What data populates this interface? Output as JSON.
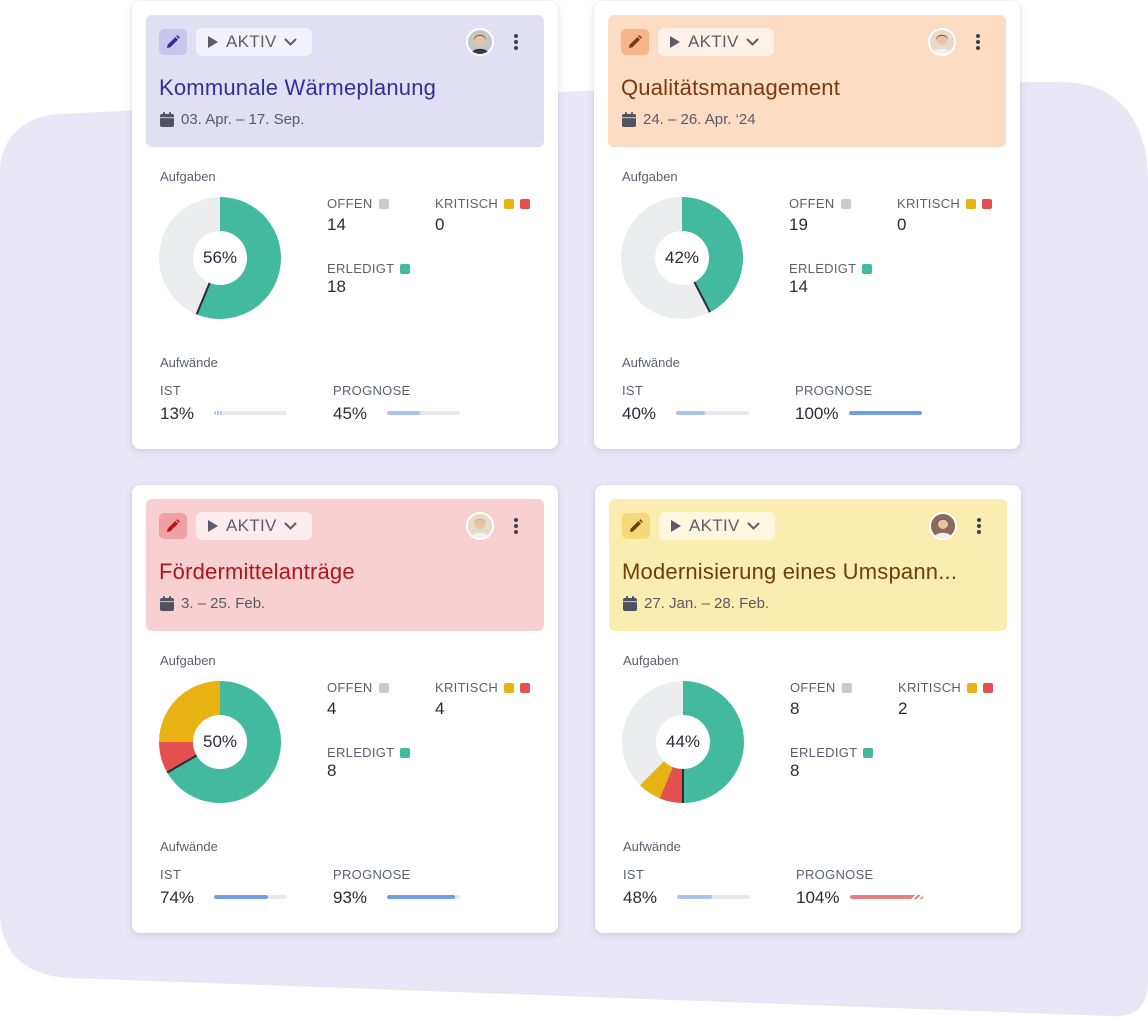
{
  "colors": {
    "done": "#43b99e",
    "open": "#ecedef",
    "critical_yellow": "#e8b213",
    "critical_red": "#e3504f",
    "open_square": "#c8cad1",
    "bar_light": "#a9c3ec",
    "bar_blue": "#6f9fe0",
    "bar_red": "#ea7c7d",
    "blob": "#e9e7f6"
  },
  "labels": {
    "tasks": "Aufgaben",
    "effort": "Aufwände",
    "open": "OFFEN",
    "critical": "KRITISCH",
    "done": "ERLEDIGT",
    "actual": "IST",
    "forecast": "PROGNOSE"
  },
  "cards": [
    {
      "status": "AKTIV",
      "title": "Kommunale Wärmeplanung",
      "dates": "03. Apr. – 17. Sep.",
      "header_bg": "#e0dff3",
      "accent": "#33309a",
      "edit_bg": "#c9c6ee",
      "avatar_icon": "avatar-man-icon",
      "percent": "56%",
      "open": "14",
      "critical": "0",
      "done": "18",
      "critical_yellow": 0,
      "critical_red": 0,
      "actual": "13%",
      "forecast": "45%",
      "actual_fill": 0.13,
      "forecast_fill": 0.45,
      "actual_color": "#a9c3ec",
      "forecast_color": "#a9c3ec"
    },
    {
      "status": "AKTIV",
      "title": "Qualitätsmanagement",
      "dates": "24. – 26. Apr. ‘24",
      "header_bg": "#fddcc4",
      "accent": "#7c3a0c",
      "edit_bg": "#f7b689",
      "avatar_icon": "avatar-woman-icon",
      "percent": "42%",
      "open": "19",
      "critical": "0",
      "done": "14",
      "critical_yellow": 0,
      "critical_red": 0,
      "actual": "40%",
      "forecast": "100%",
      "actual_fill": 0.4,
      "forecast_fill": 1.0,
      "actual_color": "#a9c3ec",
      "forecast_color": "#6f9fe0"
    },
    {
      "status": "AKTIV",
      "title": "Fördermittelanträge",
      "dates": "3. – 25. Feb.",
      "header_bg": "#f8d0d2",
      "accent": "#b01717",
      "edit_bg": "#f0a1a4",
      "avatar_icon": "avatar-woman-icon",
      "percent": "50%",
      "open": "4",
      "critical": "4",
      "done": "8",
      "critical_yellow": 3,
      "critical_red": 1,
      "actual": "74%",
      "forecast": "93%",
      "actual_fill": 0.74,
      "forecast_fill": 0.93,
      "actual_color": "#6f9fe0",
      "forecast_color": "#6f9fe0"
    },
    {
      "status": "AKTIV",
      "title": "Modernisierung eines Umspann...",
      "dates": "27. Jan. – 28. Feb.",
      "header_bg": "#fbecb0",
      "accent": "#6a4208",
      "edit_bg": "#f6d97a",
      "avatar_icon": "avatar-woman-icon",
      "percent": "44%",
      "open": "8",
      "critical": "2",
      "done": "8",
      "critical_yellow": 1,
      "critical_red": 1,
      "actual": "48%",
      "forecast": "104%",
      "actual_fill": 0.48,
      "forecast_fill": 1.04,
      "actual_color": "#a9c3ec",
      "forecast_color": "#ea7c7d"
    }
  ]
}
